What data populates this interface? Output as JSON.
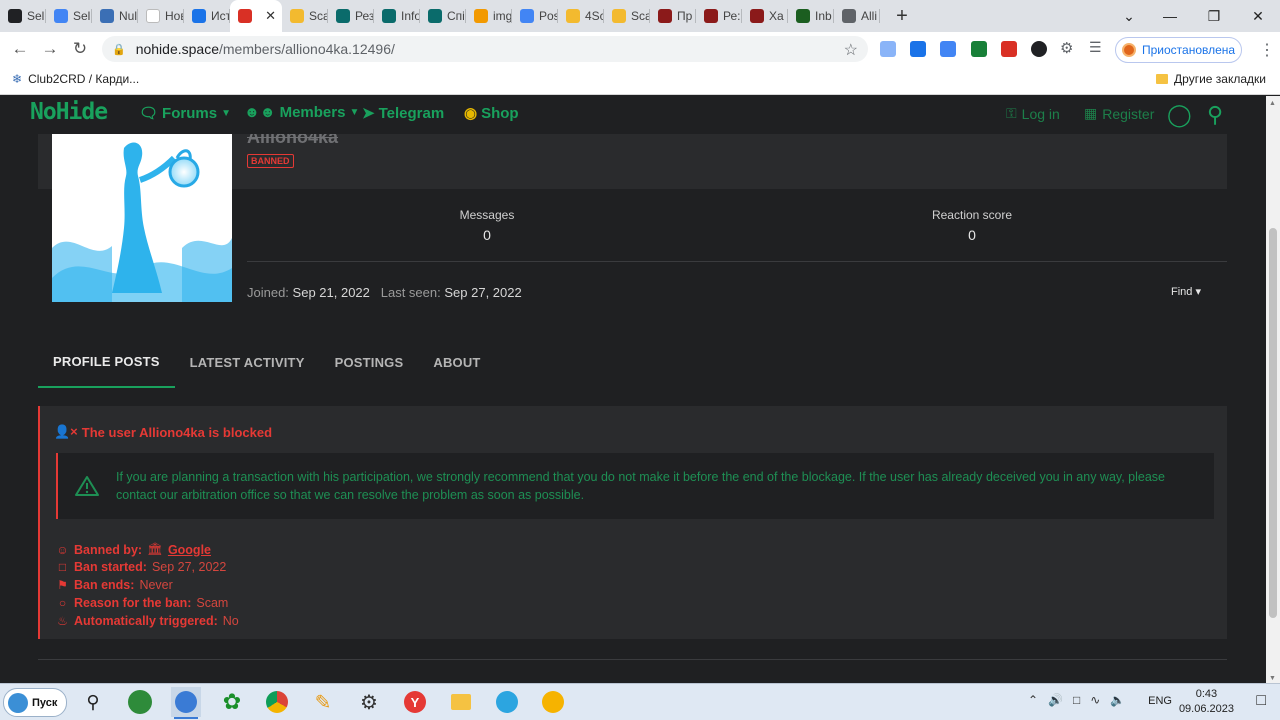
{
  "browser": {
    "tabs": [
      {
        "title": "Sell",
        "color": "#202124"
      },
      {
        "title": "Sell",
        "color": "#4285f4"
      },
      {
        "title": "Nul",
        "color": "#3b6fb5"
      },
      {
        "title": "Новая в",
        "color": "#ffffff"
      },
      {
        "title": "Ист",
        "color": "#1a73e8"
      },
      {
        "title": "",
        "color": "#d93025"
      },
      {
        "title": "Sca",
        "color": "#f3ba2f"
      },
      {
        "title": "Рез",
        "color": "#0a6b6b"
      },
      {
        "title": "Info",
        "color": "#0a6b6b"
      },
      {
        "title": "Спі",
        "color": "#0a6b6b"
      },
      {
        "title": "img",
        "color": "#f29900"
      },
      {
        "title": "Pos",
        "color": "#4285f4"
      },
      {
        "title": "4Sc",
        "color": "#f3ba2f"
      },
      {
        "title": "Sca",
        "color": "#f3ba2f"
      },
      {
        "title": "Пр",
        "color": "#8b1a1a"
      },
      {
        "title": "Ре:",
        "color": "#8b1a1a"
      },
      {
        "title": "Ха",
        "color": "#8b1a1a"
      },
      {
        "title": "Inb",
        "color": "#1b5e20"
      },
      {
        "title": "Alli",
        "color": "#5f6368"
      }
    ],
    "new_tab": "+",
    "controls": {
      "minimize": "—",
      "restore": "❐",
      "close": "✕",
      "tab_search": "⌄"
    },
    "url_domain": "nohide.space",
    "url_path": "/members/alliono4ka.12496/",
    "paused_label": "Приостановлена",
    "bookmarks": {
      "first": "Club2CRD / Карди...",
      "other": "Другие закладки"
    }
  },
  "site": {
    "logo": "NoHide",
    "nav": {
      "forums": "Forums",
      "members": "Members",
      "telegram": "Telegram",
      "shop": "Shop",
      "login": "Log in",
      "register": "Register"
    },
    "profile": {
      "username": "Alliono4ka",
      "badge": "BANNED",
      "messages_label": "Messages",
      "messages_value": "0",
      "reaction_label": "Reaction score",
      "reaction_value": "0",
      "joined_label": "Joined:",
      "joined_value": "Sep 21, 2022",
      "last_seen_label": "Last seen:",
      "last_seen_value": "Sep 27, 2022",
      "find_label": "Find"
    },
    "tabs": [
      "PROFILE POSTS",
      "LATEST ACTIVITY",
      "POSTINGS",
      "ABOUT"
    ],
    "ban": {
      "title": "The user Alliono4ka is blocked",
      "warning": "If you are planning a transaction with his participation, we strongly recommend that you do not make it before the end of the blockage. If the user has already deceived you in any way, please contact our arbitration office so that we can resolve the problem as soon as possible.",
      "banned_by_label": "Banned by:",
      "banned_by_value": "Google",
      "ban_started_label": "Ban started:",
      "ban_started_value": "Sep 27, 2022",
      "ban_ends_label": "Ban ends:",
      "ban_ends_value": "Never",
      "reason_label": "Reason for the ban:",
      "reason_value": "Scam",
      "auto_label": "Automatically triggered:",
      "auto_value": "No"
    }
  },
  "taskbar": {
    "start_label": "Пуск",
    "lang": "ENG",
    "time": "0:43",
    "date": "09.06.2023"
  }
}
